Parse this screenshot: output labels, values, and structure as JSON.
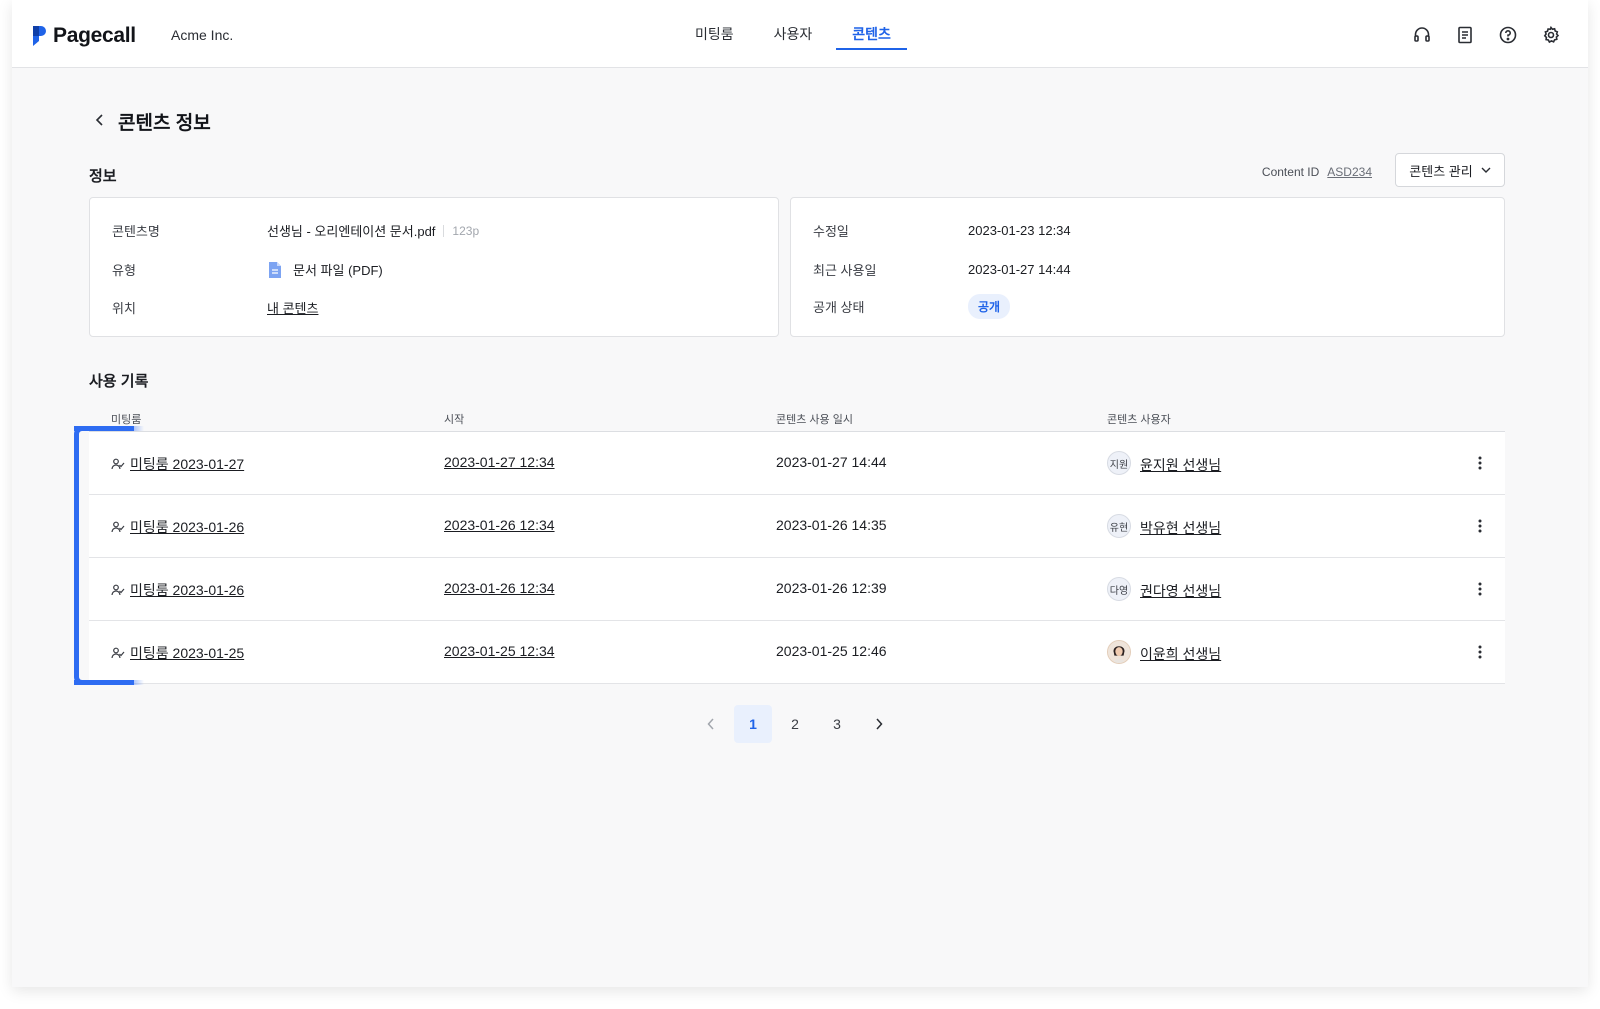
{
  "app": {
    "name": "Pagecall",
    "organization": "Acme Inc."
  },
  "nav": {
    "tabs": [
      {
        "label": "미팅룸",
        "active": false
      },
      {
        "label": "사용자",
        "active": false
      },
      {
        "label": "콘텐츠",
        "active": true
      }
    ]
  },
  "header_icons": [
    "headset-icon",
    "document-icon",
    "help-icon",
    "settings-icon"
  ],
  "page": {
    "title": "콘텐츠 정보"
  },
  "info": {
    "section_title": "정보",
    "content_id_label": "Content ID",
    "content_id_value": "ASD234",
    "manage_button": "콘텐츠 관리",
    "left_card": {
      "name_label": "콘텐츠명",
      "name_value": "선생님 - 오리엔테이션 문서.pdf",
      "pages": "123p",
      "type_label": "유형",
      "type_value": "문서 파일 (PDF)",
      "location_label": "위치",
      "location_value": "내 콘텐츠"
    },
    "right_card": {
      "modified_label": "수정일",
      "modified_value": "2023-01-23 12:34",
      "last_used_label": "최근 사용일",
      "last_used_value": "2023-01-27 14:44",
      "visibility_label": "공개 상태",
      "visibility_value": "공개"
    }
  },
  "usage": {
    "section_title": "사용 기록",
    "columns": [
      "미팅룸",
      "시작",
      "콘텐츠 사용 일시",
      "콘텐츠 사용자"
    ],
    "rows": [
      {
        "room": "미팅룸 2023-01-27",
        "start": "2023-01-27 12:34",
        "used_at": "2023-01-27 14:44",
        "avatar": "지원",
        "user": "윤지원 선생님"
      },
      {
        "room": "미팅룸 2023-01-26",
        "start": "2023-01-26 12:34",
        "used_at": "2023-01-26 14:35",
        "avatar": "유현",
        "user": "박유현 선생님"
      },
      {
        "room": "미팅룸 2023-01-26",
        "start": "2023-01-26 12:34",
        "used_at": "2023-01-26 12:39",
        "avatar": "다영",
        "user": "권다영 선생님"
      },
      {
        "room": "미팅룸 2023-01-25",
        "start": "2023-01-25 12:34",
        "used_at": "2023-01-25 12:46",
        "avatar": "",
        "user": "이윤희 선생님"
      }
    ]
  },
  "pagination": {
    "pages": [
      "1",
      "2",
      "3"
    ],
    "current": "1"
  },
  "colors": {
    "accent": "#1f63e8",
    "highlight": "#2e6cf2"
  }
}
